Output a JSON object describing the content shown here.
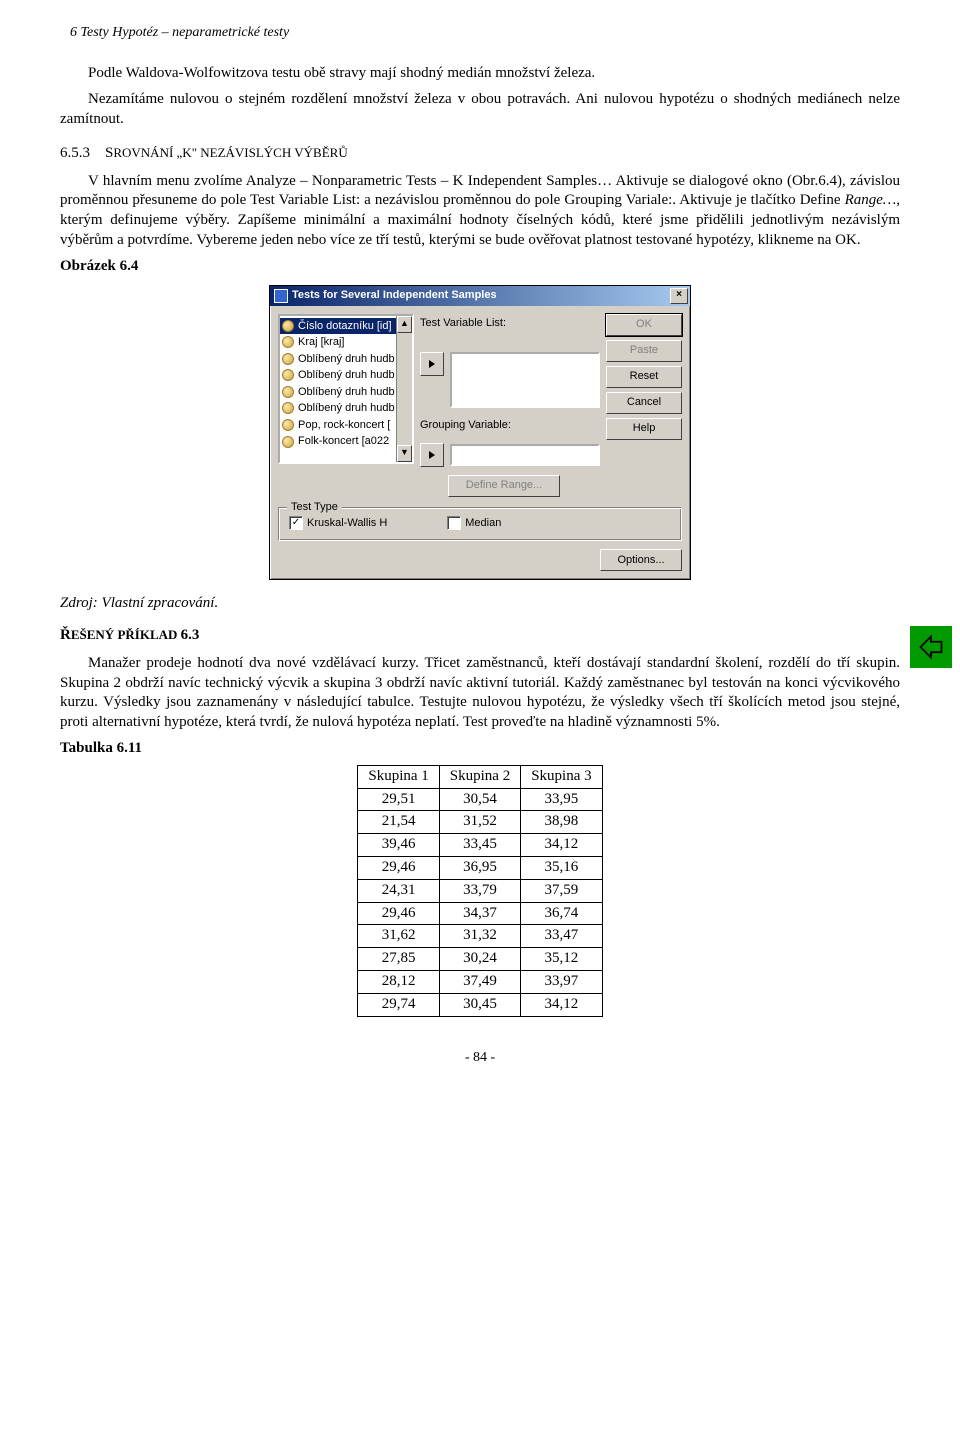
{
  "header": "6 Testy Hypotéz – neparametrické testy",
  "para1": "Podle Waldova-Wolfowitzova testu obě stravy mají shodný medián množství železa.",
  "para2": "Nezamítáme nulovou o stejném rozdělení množství železa v obou potravách. Ani nulovou hypotézu o shodných mediánech nelze zamítnout.",
  "sec": {
    "num": "6.5.3",
    "title_pre": "S",
    "title_sc": "ROVNÁNÍ „K\"  NEZÁVISLÝCH VÝBĚRŮ"
  },
  "para3_a": "V hlavním menu zvolíme Analyze – Nonparametric Tests – K Independent Samples… Aktivuje se dialogové okno (Obr.6.4), závislou proměnnou přesuneme do pole Test Variable List: a nezávislou proměnnou do pole Grouping Variale:. Aktivuje je tlačítko Define ",
  "para3_b": "Range…",
  "para3_c": ", kterým definujeme výběry. Zapíšeme minimální a maximální hodnoty číselných kódů, které jsme přidělili jednotlivým nezávislým výběrům a potvrdíme. Vybereme jeden nebo více ze tří testů, kterými se bude ověřovat platnost testované hypotézy, klikneme na OK.",
  "figcap": "Obrázek 6.4",
  "dialog": {
    "title": "Tests for Several Independent Samples",
    "items": [
      "Číslo dotazníku [id]",
      "Kraj [kraj]",
      "Oblíbený druh hudb",
      "Oblíbený druh hudb",
      "Oblíbený druh hudb",
      "Oblíbený druh hudb",
      "Pop, rock-koncert [",
      "Folk-koncert [a022"
    ],
    "test_var_label": "Test Variable List:",
    "grouping_label": "Grouping Variable:",
    "define_range": "Define Range...",
    "buttons": {
      "ok": "OK",
      "paste": "Paste",
      "reset": "Reset",
      "cancel": "Cancel",
      "help": "Help",
      "options": "Options..."
    },
    "group_title": "Test Type",
    "chk1": "Kruskal-Wallis H",
    "chk2": "Median"
  },
  "source": "Zdroj: Vlastní zpracování.",
  "example_heading_pre": "Ř",
  "example_heading_sc": "EŠENÝ PŘÍKLAD ",
  "example_heading_num": "6.3",
  "para4": "Manažer prodeje hodnotí dva nové vzdělávací kurzy. Třicet zaměstnanců, kteří dostávají standardní školení, rozdělí do tří skupin. Skupina 2 obdrží navíc technický výcvik a skupina 3 obdrží navíc aktivní tutoriál. Každý zaměstnanec byl testován na konci výcvikového kurzu. Výsledky jsou zaznamenány v následující tabulce. Testujte nulovou hypotézu, že výsledky všech tří školících metod jsou stejné, proti alternativní hypotéze, která tvrdí, že nulová hypotéza neplatí. Test proveďte na hladině významnosti 5%.",
  "tabcap": "Tabulka 6.11",
  "table": {
    "headers": [
      "Skupina 1",
      "Skupina 2",
      "Skupina 3"
    ],
    "rows": [
      [
        "29,51",
        "30,54",
        "33,95"
      ],
      [
        "21,54",
        "31,52",
        "38,98"
      ],
      [
        "39,46",
        "33,45",
        "34,12"
      ],
      [
        "29,46",
        "36,95",
        "35,16"
      ],
      [
        "24,31",
        "33,79",
        "37,59"
      ],
      [
        "29,46",
        "34,37",
        "36,74"
      ],
      [
        "31,62",
        "31,32",
        "33,47"
      ],
      [
        "27,85",
        "30,24",
        "35,12"
      ],
      [
        "28,12",
        "37,49",
        "33,97"
      ],
      [
        "29,74",
        "30,45",
        "34,12"
      ]
    ]
  },
  "pagenum": "- 84 -"
}
